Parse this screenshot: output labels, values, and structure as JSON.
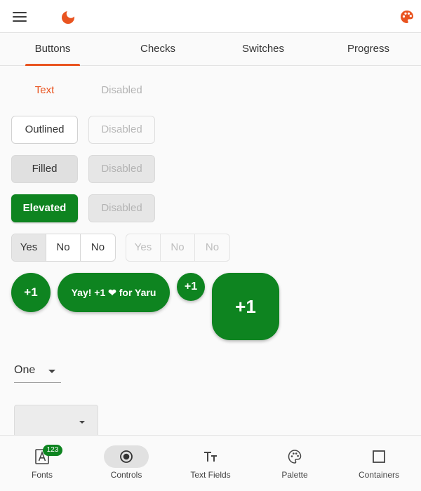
{
  "app": {
    "accent_color": "#e95420",
    "success_color": "#0e8420",
    "icons": {
      "menu": "hamburger-menu-icon",
      "logo": "yaru-moon-logo-icon",
      "theme": "palette-icon"
    }
  },
  "tabs": [
    {
      "label": "Buttons",
      "active": true
    },
    {
      "label": "Checks",
      "active": false
    },
    {
      "label": "Switches",
      "active": false
    },
    {
      "label": "Progress",
      "active": false
    }
  ],
  "buttons": {
    "text": {
      "label": "Text",
      "disabled_label": "Disabled"
    },
    "outlined": {
      "label": "Outlined",
      "disabled_label": "Disabled"
    },
    "filled": {
      "label": "Filled",
      "disabled_label": "Disabled"
    },
    "elevated": {
      "label": "Elevated",
      "disabled_label": "Disabled"
    }
  },
  "toggle_buttons": {
    "enabled": [
      {
        "label": "Yes",
        "selected": true
      },
      {
        "label": "No",
        "selected": false
      },
      {
        "label": "No",
        "selected": false
      }
    ],
    "disabled": [
      {
        "label": "Yes"
      },
      {
        "label": "No"
      },
      {
        "label": "No"
      }
    ]
  },
  "fabs": {
    "regular": "+1",
    "extended": "Yay! +1 ❤ for Yaru",
    "small": "+1",
    "large": "+1"
  },
  "dropdown": {
    "value": "One"
  },
  "filled_dropdown": {
    "value": ""
  },
  "navbar": [
    {
      "label": "Fonts",
      "icon": "font-icon",
      "badge": "123",
      "active": false
    },
    {
      "label": "Controls",
      "icon": "radio-button-icon",
      "active": true
    },
    {
      "label": "Text Fields",
      "icon": "text-format-icon",
      "active": false
    },
    {
      "label": "Palette",
      "icon": "palette-icon",
      "active": false
    },
    {
      "label": "Containers",
      "icon": "square-outline-icon",
      "active": false
    }
  ]
}
